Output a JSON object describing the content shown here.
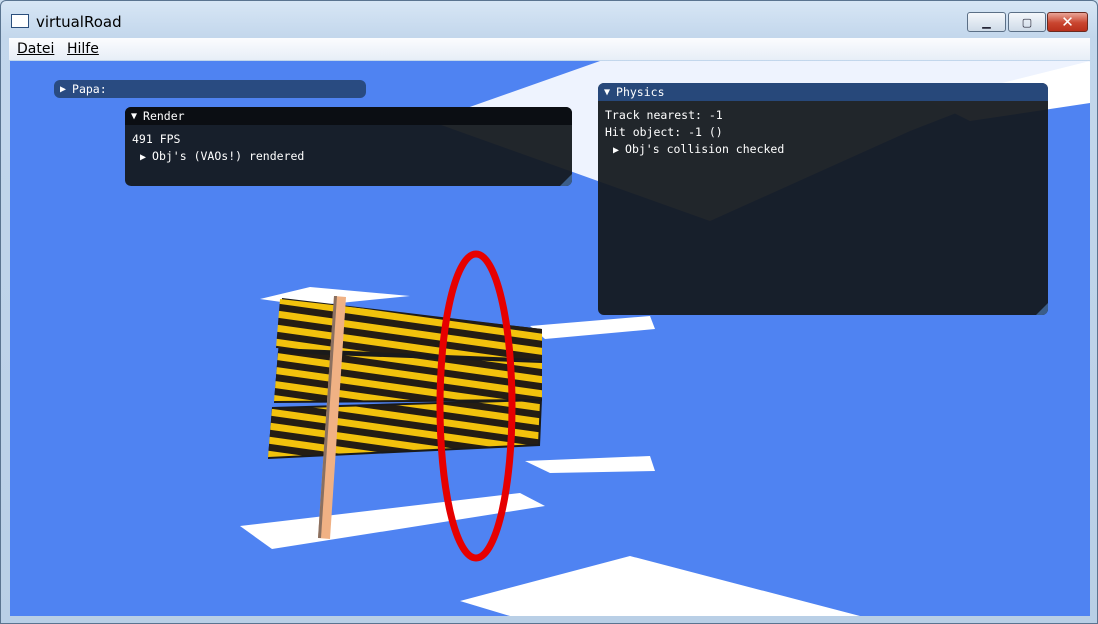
{
  "window": {
    "title": "virtualRoad",
    "minimize_glyph": "▁",
    "maximize_glyph": "▢",
    "close_glyph": "✕"
  },
  "menu": {
    "items": [
      {
        "label": "Datei"
      },
      {
        "label": "Hilfe"
      }
    ]
  },
  "panels": {
    "papa": {
      "title": "Papa:",
      "collapsed_glyph": "▶"
    },
    "render": {
      "title": "Render",
      "expanded_glyph": "▼",
      "fps": "491 FPS",
      "tree_item": "Obj's (VAOs!) rendered",
      "tree_glyph": "▶"
    },
    "physics": {
      "title": "Physics",
      "expanded_glyph": "▼",
      "track_nearest": "Track nearest: -1",
      "hit_object": "Hit object: -1 ()",
      "tree_item": "Obj's collision checked",
      "tree_glyph": "▶"
    }
  },
  "colors": {
    "sky": "#4f83f2",
    "panel_bg": "#14181e",
    "header_active": "#27487a",
    "header_inactive": "#0b0e13",
    "ring": "#e60000",
    "stripe_yellow": "#f2c20c",
    "post": "#f0b184"
  },
  "icons": {
    "app": "window-icon",
    "minimize": "minimize-icon",
    "maximize": "maximize-icon",
    "close": "close-icon"
  }
}
